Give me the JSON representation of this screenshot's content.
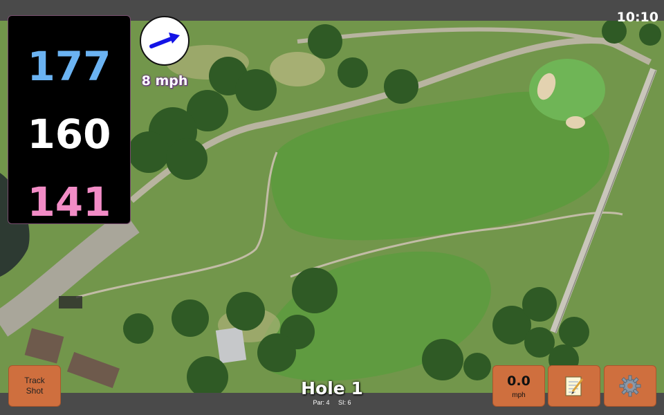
{
  "status": {
    "time": "10:10"
  },
  "distances": {
    "back": "177",
    "middle": "160",
    "front": "141"
  },
  "wind": {
    "speed_label": "8 mph",
    "direction_icon": "arrow-northeast-icon"
  },
  "buttons": {
    "track_shot_line1": "Track",
    "track_shot_line2": "Shot",
    "speed_value": "0.0",
    "speed_unit": "mph",
    "notes_icon": "notepad-icon",
    "settings_icon": "gear-icon"
  },
  "hole": {
    "title": "Hole 1",
    "par": "Par: 4",
    "si": "SI: 6"
  },
  "colors": {
    "back_distance": "#6bb3f2",
    "middle_distance": "#ffffff",
    "front_distance": "#f28cc6",
    "button_orange": "#cf6f3e",
    "bar_gray": "#4a4a4a"
  }
}
